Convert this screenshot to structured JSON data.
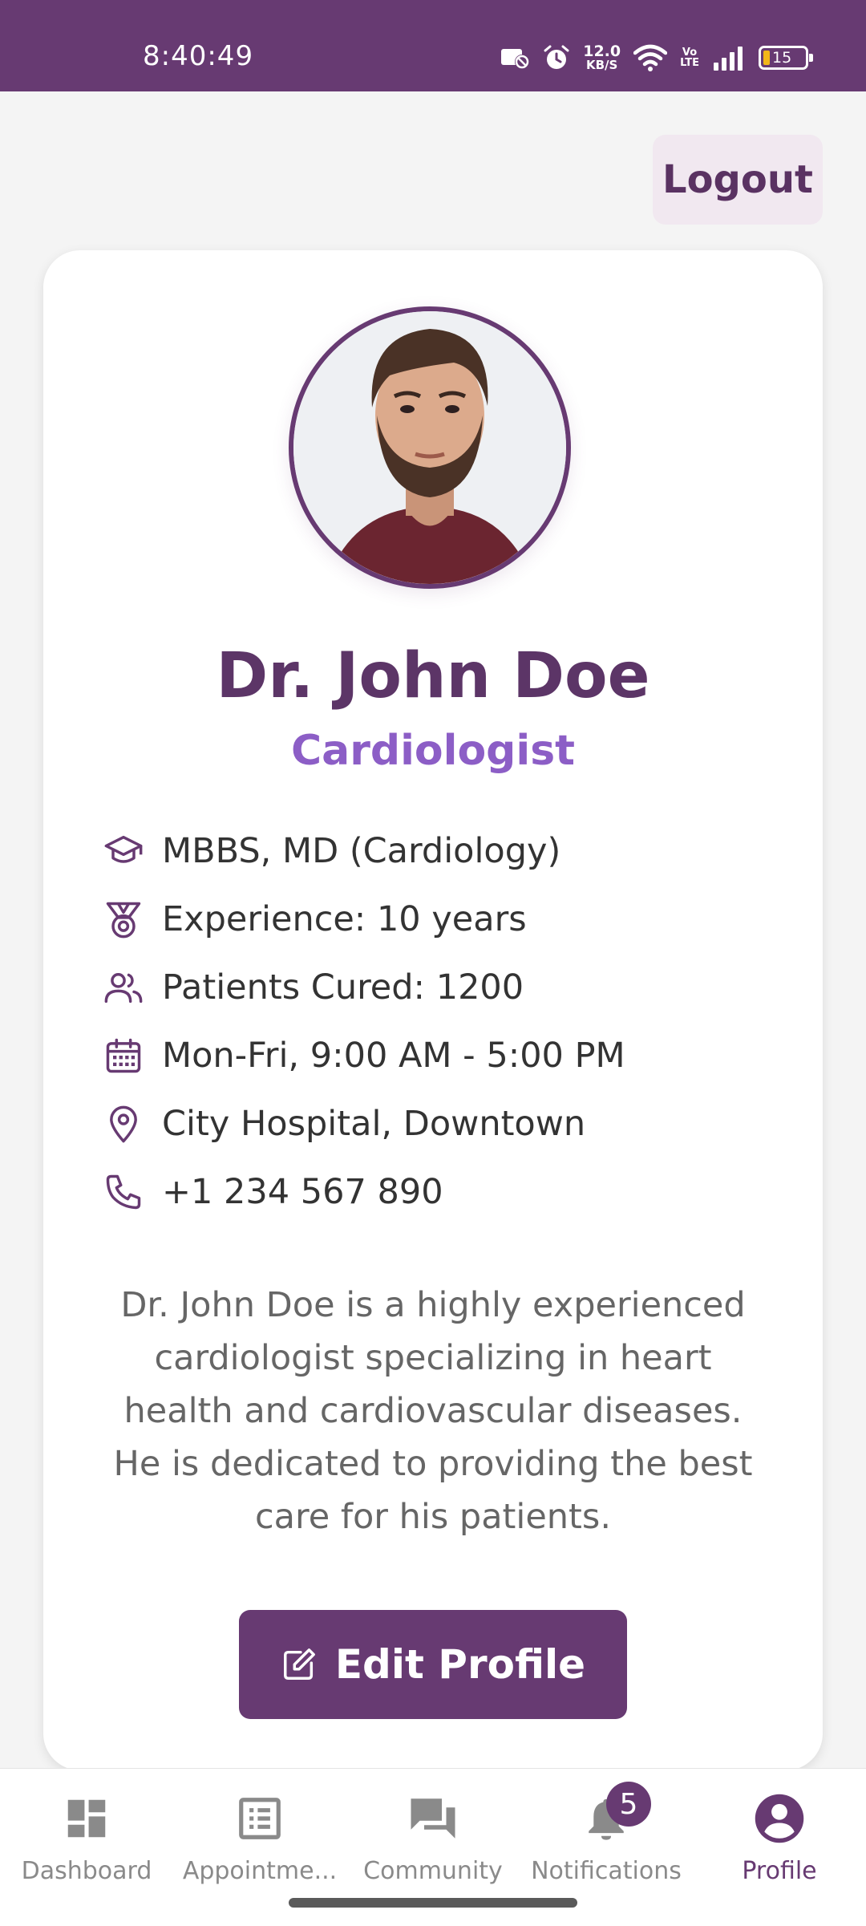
{
  "status_bar": {
    "time": "8:40:49",
    "net_speed_value": "12.0",
    "net_speed_unit": "KB/S",
    "lte_top": "Vo",
    "lte_bottom": "LTE",
    "battery": "15",
    "battery_color": "#f2b619"
  },
  "header": {
    "logout_label": "Logout"
  },
  "profile": {
    "name": "Dr. John Doe",
    "specialty": "Cardiologist",
    "details": [
      {
        "icon": "graduation-cap-icon",
        "text": "MBBS, MD (Cardiology)"
      },
      {
        "icon": "medal-icon",
        "text": "Experience: 10 years"
      },
      {
        "icon": "users-icon",
        "text": "Patients Cured: 1200"
      },
      {
        "icon": "calendar-icon",
        "text": "Mon-Fri, 9:00 AM - 5:00 PM"
      },
      {
        "icon": "map-pin-icon",
        "text": "City Hospital, Downtown"
      },
      {
        "icon": "phone-icon",
        "text": "+1 234 567 890"
      }
    ],
    "bio": "Dr. John Doe is a highly experienced cardiologist specializing in heart health and cardiovascular diseases. He is dedicated to providing the best care for his patients.",
    "edit_label": "Edit Profile"
  },
  "bottom_nav": {
    "items": [
      {
        "label": "Dashboard",
        "icon": "dashboard-icon",
        "active": false
      },
      {
        "label": "Appointme...",
        "icon": "list-icon",
        "active": false
      },
      {
        "label": "Community",
        "icon": "chat-icon",
        "active": false
      },
      {
        "label": "Notifications",
        "icon": "bell-icon",
        "active": false,
        "badge": "5"
      },
      {
        "label": "Profile",
        "icon": "account-circle-icon",
        "active": true
      }
    ]
  },
  "colors": {
    "primary": "#673a72",
    "accent": "#8c5ec6",
    "background": "#f4f4f4"
  }
}
